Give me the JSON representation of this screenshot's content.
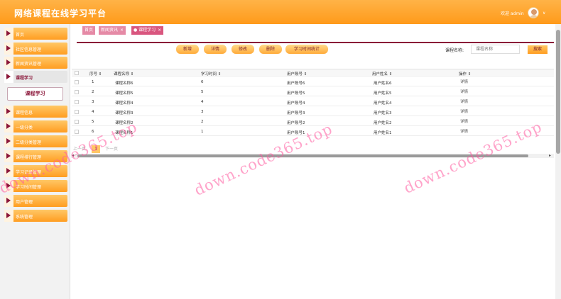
{
  "header": {
    "title": "网络课程在线学习平台",
    "welcome": "欢迎 admin",
    "caret": "∨"
  },
  "sidebar": {
    "items": [
      {
        "label": "首页"
      },
      {
        "label": "社区信息管理"
      },
      {
        "label": "新闻资讯管理"
      },
      {
        "label": "课程学习"
      },
      {
        "label": "课程信息"
      },
      {
        "label": "一级分类"
      },
      {
        "label": "二级分类管理"
      },
      {
        "label": "课程排行管理"
      },
      {
        "label": "学习记录管理"
      },
      {
        "label": "学习时间管理"
      },
      {
        "label": "用户管理"
      },
      {
        "label": "系统管理"
      }
    ],
    "submenu": "课程学习"
  },
  "tabs": [
    {
      "label": "首页",
      "close": ""
    },
    {
      "label": "新闻资讯",
      "close": "×"
    },
    {
      "label": "● 课程学习",
      "close": "×"
    }
  ],
  "toolbar": {
    "add": "新增",
    "detail": "详情",
    "edit": "修改",
    "delete": "删除",
    "stats": "学习时间统计",
    "search_label": "课程名称:",
    "search_placeholder": "课程名称",
    "search_button": "搜索"
  },
  "table": {
    "headers": [
      "序号 ⇕",
      "课程名称 ⇕",
      "学习时间 ⇕",
      "用户账号 ⇕",
      "用户姓名 ⇕",
      "操作 ⇕"
    ],
    "rows": [
      {
        "no": "1",
        "course": "课程名称6",
        "time": "6",
        "account": "用户账号6",
        "name": "用户姓名6",
        "op": "详情"
      },
      {
        "no": "2",
        "course": "课程名称5",
        "time": "5",
        "account": "用户账号5",
        "name": "用户姓名5",
        "op": "详情"
      },
      {
        "no": "3",
        "course": "课程名称4",
        "time": "4",
        "account": "用户账号4",
        "name": "用户姓名4",
        "op": "详情"
      },
      {
        "no": "4",
        "course": "课程名称3",
        "time": "3",
        "account": "用户账号3",
        "name": "用户姓名3",
        "op": "详情"
      },
      {
        "no": "5",
        "course": "课程名称2",
        "time": "2",
        "account": "用户账号2",
        "name": "用户姓名2",
        "op": "详情"
      },
      {
        "no": "6",
        "course": "课程名称1",
        "time": "1",
        "account": "用户账号1",
        "name": "用户姓名1",
        "op": "详情"
      }
    ]
  },
  "pager": {
    "prev": "上一页",
    "page": "1",
    "next": "下一页"
  },
  "scroll": {
    "left_arrow": "◂",
    "right_arrow": "▸"
  },
  "watermark": {
    "text": "down.code365.top"
  },
  "colors": {
    "accent": "#ff9d21",
    "brand": "#8a1538"
  },
  "icons": [
    "avatar-icon",
    "menu-triangle-icon",
    "close-icon",
    "sort-icon",
    "checkbox-icon"
  ]
}
